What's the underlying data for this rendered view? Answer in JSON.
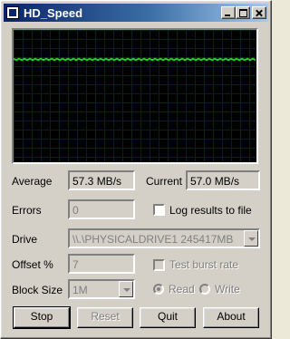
{
  "window": {
    "title": "HD_Speed"
  },
  "graph": {
    "grid_color": "#0000c0",
    "background": "#000000",
    "line_color": "#22cc22",
    "level_fraction_from_top": 0.22
  },
  "stats": {
    "average_label": "Average",
    "average_value": "57.3 MB/s",
    "current_label": "Current",
    "current_value": "57.0 MB/s",
    "errors_label": "Errors",
    "errors_value": "0",
    "log_label": "Log results to file",
    "log_checked": false
  },
  "drive": {
    "label": "Drive",
    "value": "\\\\.\\PHYSICALDRIVE1    245417MB"
  },
  "offset": {
    "label": "Offset %",
    "value": "7",
    "burst_label": "Test burst rate"
  },
  "block": {
    "label": "Block Size",
    "value": "1M",
    "read_label": "Read",
    "write_label": "Write",
    "selected": "Read"
  },
  "buttons": {
    "stop": "Stop",
    "reset": "Reset",
    "quit": "Quit",
    "about": "About"
  }
}
